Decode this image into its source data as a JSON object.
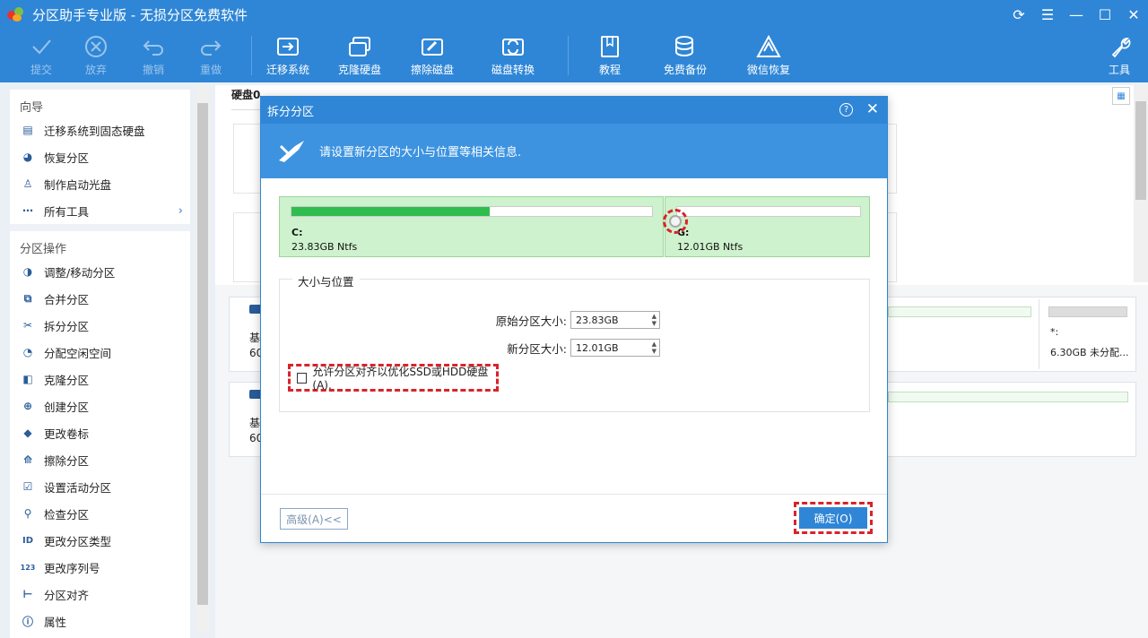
{
  "window": {
    "title": "分区助手专业版 - 无损分区免费软件"
  },
  "toolbar": {
    "commit": "提交",
    "discard": "放弃",
    "undo": "撤销",
    "redo": "重做",
    "migrate": "迁移系统",
    "clone_disk": "克隆硬盘",
    "wipe_disk": "擦除磁盘",
    "convert_disk": "磁盘转换",
    "tutorial": "教程",
    "free_backup": "免费备份",
    "wechat_restore": "微信恢复",
    "tools": "工具"
  },
  "sidebar": {
    "wizard_title": "向导",
    "wizard_items": [
      {
        "label": "迁移系统到固态硬盘",
        "icon": "ssd-migrate-icon"
      },
      {
        "label": "恢复分区",
        "icon": "pie-restore-icon"
      },
      {
        "label": "制作启动光盘",
        "icon": "boot-disk-icon"
      },
      {
        "label": "所有工具",
        "icon": "more-dots-icon"
      }
    ],
    "ops_title": "分区操作",
    "ops_items": [
      {
        "label": "调整/移动分区"
      },
      {
        "label": "合并分区"
      },
      {
        "label": "拆分分区"
      },
      {
        "label": "分配空闲空间"
      },
      {
        "label": "克隆分区"
      },
      {
        "label": "创建分区"
      },
      {
        "label": "更改卷标"
      },
      {
        "label": "擦除分区"
      },
      {
        "label": "设置活动分区"
      },
      {
        "label": "检查分区"
      },
      {
        "label": "更改分区类型"
      },
      {
        "label": "更改序列号"
      },
      {
        "label": "分区对齐"
      },
      {
        "label": "属性"
      }
    ]
  },
  "main": {
    "disk_label": "硬盘0",
    "card1": {
      "line1": "基",
      "line2": "60"
    },
    "card2": {
      "line1": "基",
      "line2": "60"
    },
    "right_card": {
      "name": "*:",
      "info": "6.30GB 未分配..."
    }
  },
  "dialog": {
    "title": "拆分分区",
    "help": "?",
    "header_text": "请设置新分区的大小与位置等相关信息.",
    "part_c": {
      "name": "C:",
      "info": "23.83GB Ntfs",
      "fill_percent": 55
    },
    "part_g": {
      "name": "G:",
      "info": "12.01GB Ntfs",
      "fill_percent": 0
    },
    "section_title": "大小与位置",
    "orig_label": "原始分区大小:",
    "orig_value": "23.83GB",
    "new_label": "新分区大小:",
    "new_value": "12.01GB",
    "checkbox_label": "允许分区对齐以优化SSD或HDD硬盘(A).",
    "advanced_button": "高级(A)<<",
    "ok_button": "确定(O)"
  }
}
